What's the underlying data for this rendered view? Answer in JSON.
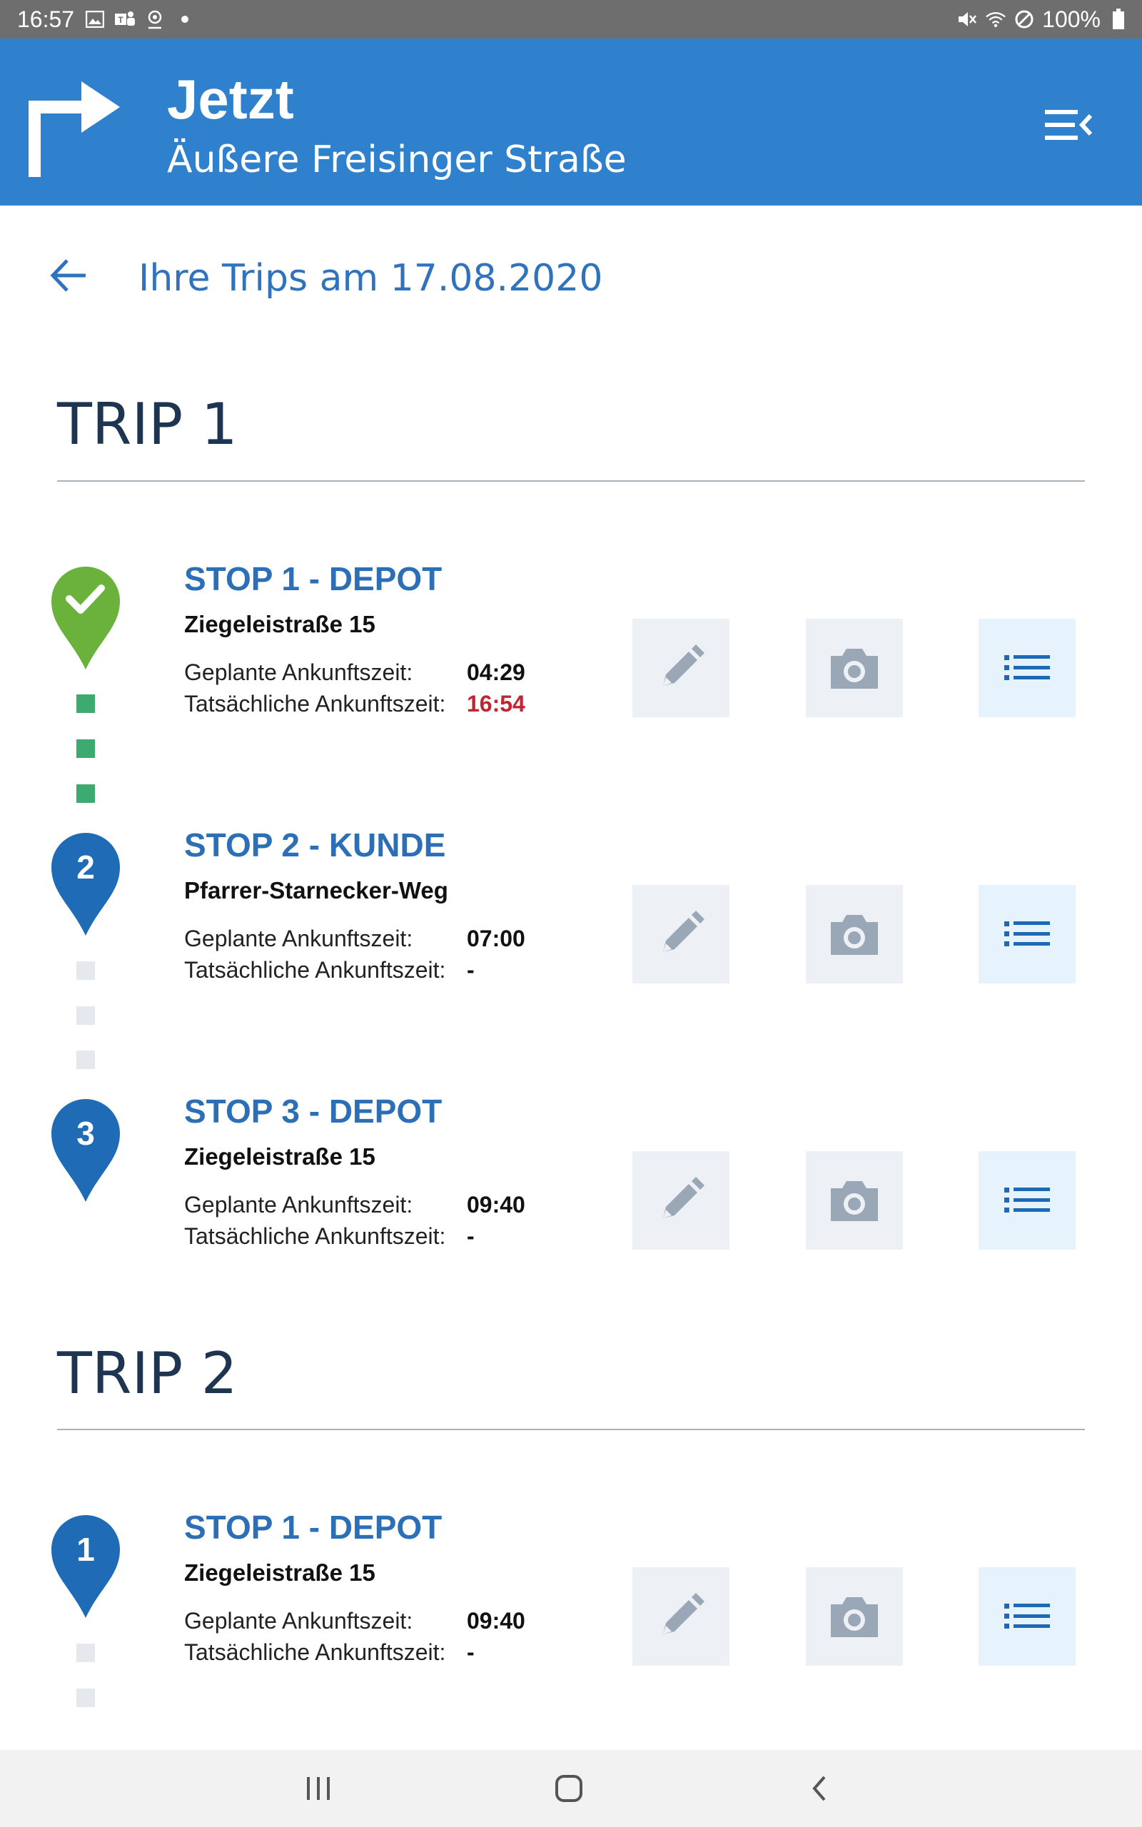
{
  "status_bar": {
    "time": "16:57",
    "battery": "100%",
    "left_icons": [
      "gallery-icon",
      "teams-icon",
      "location-icon",
      "dot-icon"
    ],
    "right_icons": [
      "mute-icon",
      "wifi-icon",
      "block-icon",
      "battery-icon"
    ]
  },
  "header": {
    "title": "Jetzt",
    "subtitle": "Äußere Freisinger Straße",
    "color": "#2f80cd"
  },
  "page": {
    "title": "Ihre Trips am 17.08.2020"
  },
  "trips": [
    {
      "heading": "TRIP 1",
      "stops": [
        {
          "title": "STOP 1 - DEPOT",
          "address": "Ziegeleistraße 15",
          "planned_label": "Geplante Ankunftszeit:",
          "planned_time": "04:29",
          "actual_label": "Tatsächliche Ankunftszeit:",
          "actual_time": "16:54",
          "status": "completed",
          "marker": "check-icon"
        },
        {
          "title": "STOP 2 - KUNDE",
          "address": "Pfarrer-Starnecker-Weg",
          "planned_label": "Geplante Ankunftszeit:",
          "planned_time": "07:00",
          "actual_label": "Tatsächliche Ankunftszeit:",
          "actual_time": "-",
          "status": "pending",
          "marker": "2"
        },
        {
          "title": "STOP 3 - DEPOT",
          "address": "Ziegeleistraße 15",
          "planned_label": "Geplante Ankunftszeit:",
          "planned_time": "09:40",
          "actual_label": "Tatsächliche Ankunftszeit:",
          "actual_time": "-",
          "status": "pending",
          "marker": "3"
        }
      ]
    },
    {
      "heading": "TRIP 2",
      "stops": [
        {
          "title": "STOP 1 - DEPOT",
          "address": "Ziegeleistraße 15",
          "planned_label": "Geplante Ankunftszeit:",
          "planned_time": "09:40",
          "actual_label": "Tatsächliche Ankunftszeit:",
          "actual_time": "-",
          "status": "pending",
          "marker": "1"
        }
      ]
    }
  ],
  "colors": {
    "accent": "#2f80cd",
    "stop_title": "#2c6fb6",
    "completed": "#6ab23c",
    "pending_pin": "#1f6bb5",
    "late": "#c0262f",
    "connector_done": "#3daa6f",
    "connector_todo": "#e5e9ee"
  },
  "nav_bar": {
    "icons": [
      "recent-apps-icon",
      "home-icon",
      "back-nav-icon"
    ]
  }
}
